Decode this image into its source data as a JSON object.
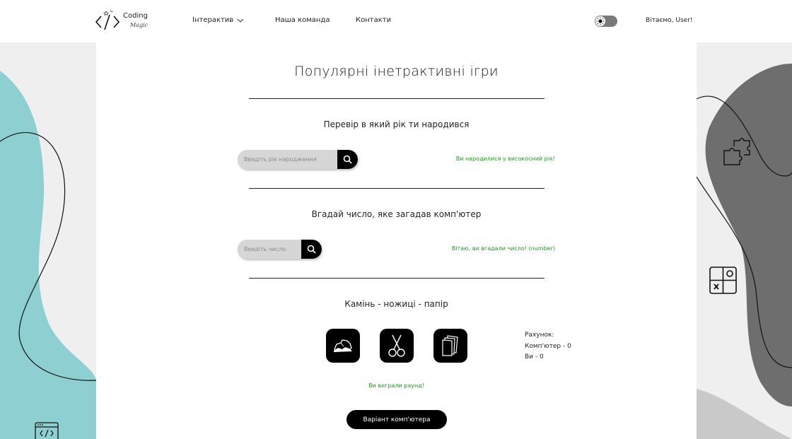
{
  "header": {
    "logo": {
      "word": "Coding",
      "script": "Magic"
    },
    "nav": [
      {
        "label": "Інтерактив"
      },
      {
        "label": "Наша команда"
      },
      {
        "label": "Контакти"
      }
    ],
    "greeting": "Вітаємо, User!"
  },
  "main": {
    "title": "Популярні інетрактивні ігри",
    "leap_year": {
      "title": "Перевір в який рік ти народився",
      "placeholder": "Введіть рік народження",
      "result": "Ви народилися у високосний рік!"
    },
    "guess_number": {
      "title": "Вгадай число, яке загадав комп'ютер",
      "placeholder": "Введіть число",
      "result": "Вітаю, ви вгадали число! (number)"
    },
    "rps": {
      "title": "Камінь - ножиці - папір",
      "score_label": "Рахунок:",
      "computer_score": "Комп'ютер - 0",
      "user_score": "Ви - 0",
      "round_result": "Ви виграли раунд!",
      "computer_button": "Варіант комп'ютера"
    }
  },
  "colors": {
    "teal": "#8ecfd1",
    "dark_gray": "#6e6e6e",
    "light_gray": "#efefef",
    "success_green": "#1f9a1f"
  }
}
